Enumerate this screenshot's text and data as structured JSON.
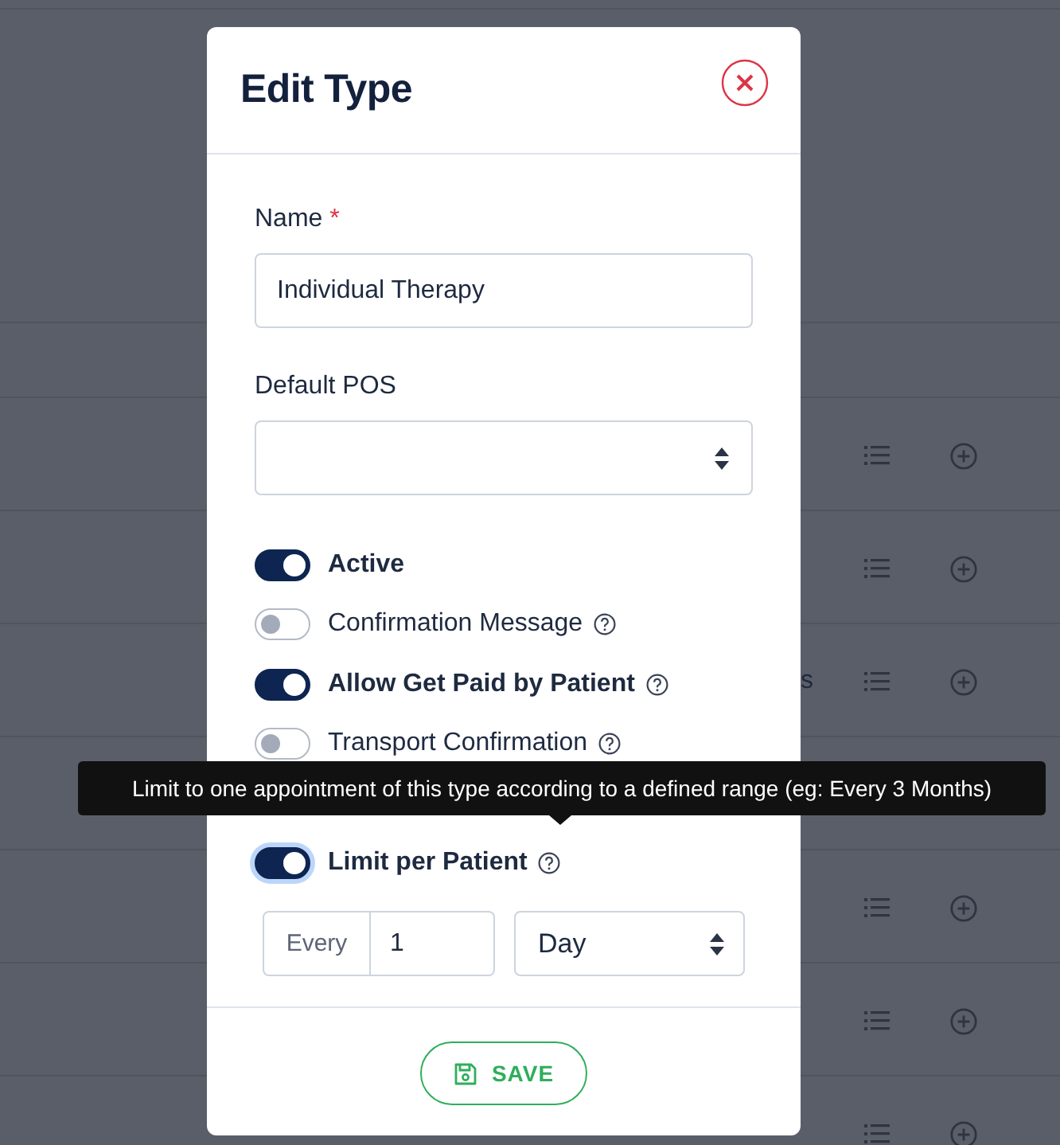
{
  "background_rows": [
    {
      "kind": "band"
    },
    {
      "kind": "gap"
    },
    {
      "kind": "header"
    },
    {
      "kind": "item"
    },
    {
      "kind": "item"
    },
    {
      "kind": "item",
      "column_3": "s"
    },
    {
      "kind": "covered"
    },
    {
      "kind": "item"
    },
    {
      "kind": "item"
    },
    {
      "kind": "item"
    }
  ],
  "modal": {
    "title": "Edit Type",
    "name_field": {
      "label": "Name",
      "required_mark": "*",
      "value": "Individual Therapy"
    },
    "pos_field": {
      "label": "Default POS"
    },
    "toggles": [
      {
        "kind": "toggle",
        "label": "Active",
        "on": true,
        "help": false,
        "focused": false
      },
      {
        "kind": "toggle",
        "label": "Confirmation Message",
        "on": false,
        "help": true,
        "focused": false
      },
      {
        "kind": "toggle",
        "label": "Allow Get Paid by Patient",
        "on": true,
        "help": true,
        "focused": false
      },
      {
        "kind": "toggle",
        "label": "Transport Confirmation",
        "on": false,
        "help": true,
        "focused": false
      },
      {
        "kind": "covered"
      },
      {
        "kind": "toggle",
        "label": "Limit per Patient",
        "on": true,
        "help": true,
        "focused": true
      }
    ],
    "limit": {
      "prefix": "Every",
      "value": "1",
      "unit": "Day"
    },
    "save_button": "SAVE"
  },
  "tooltip": "Limit to one appointment of this type according to a defined range (eg: Every 3 Months)"
}
